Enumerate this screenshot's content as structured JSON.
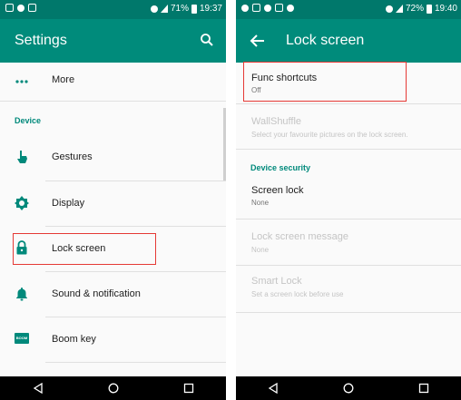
{
  "left": {
    "status": {
      "battery": "71%",
      "time": "19:37"
    },
    "appbar": {
      "title": "Settings"
    },
    "more_label": "More",
    "device_header": "Device",
    "items": [
      {
        "label": "Gestures"
      },
      {
        "label": "Display"
      },
      {
        "label": "Lock screen"
      },
      {
        "label": "Sound & notification"
      },
      {
        "label": "Boom key",
        "icon_text": "BOOM"
      }
    ]
  },
  "right": {
    "status": {
      "battery": "72%",
      "time": "19:40"
    },
    "appbar": {
      "title": "Lock screen"
    },
    "func_shortcuts": {
      "title": "Func shortcuts",
      "summary": "Off"
    },
    "wallshuffle": {
      "title": "WallShuffle",
      "summary": "Select your favourite pictures on the lock screen."
    },
    "device_security_header": "Device security",
    "screen_lock": {
      "title": "Screen lock",
      "summary": "None"
    },
    "lock_message": {
      "title": "Lock screen message",
      "summary": "None"
    },
    "smart_lock": {
      "title": "Smart Lock",
      "summary": "Set a screen lock before use"
    }
  },
  "colors": {
    "accent": "#008b7b",
    "statusbar": "#00786b",
    "highlight": "#e53935"
  }
}
